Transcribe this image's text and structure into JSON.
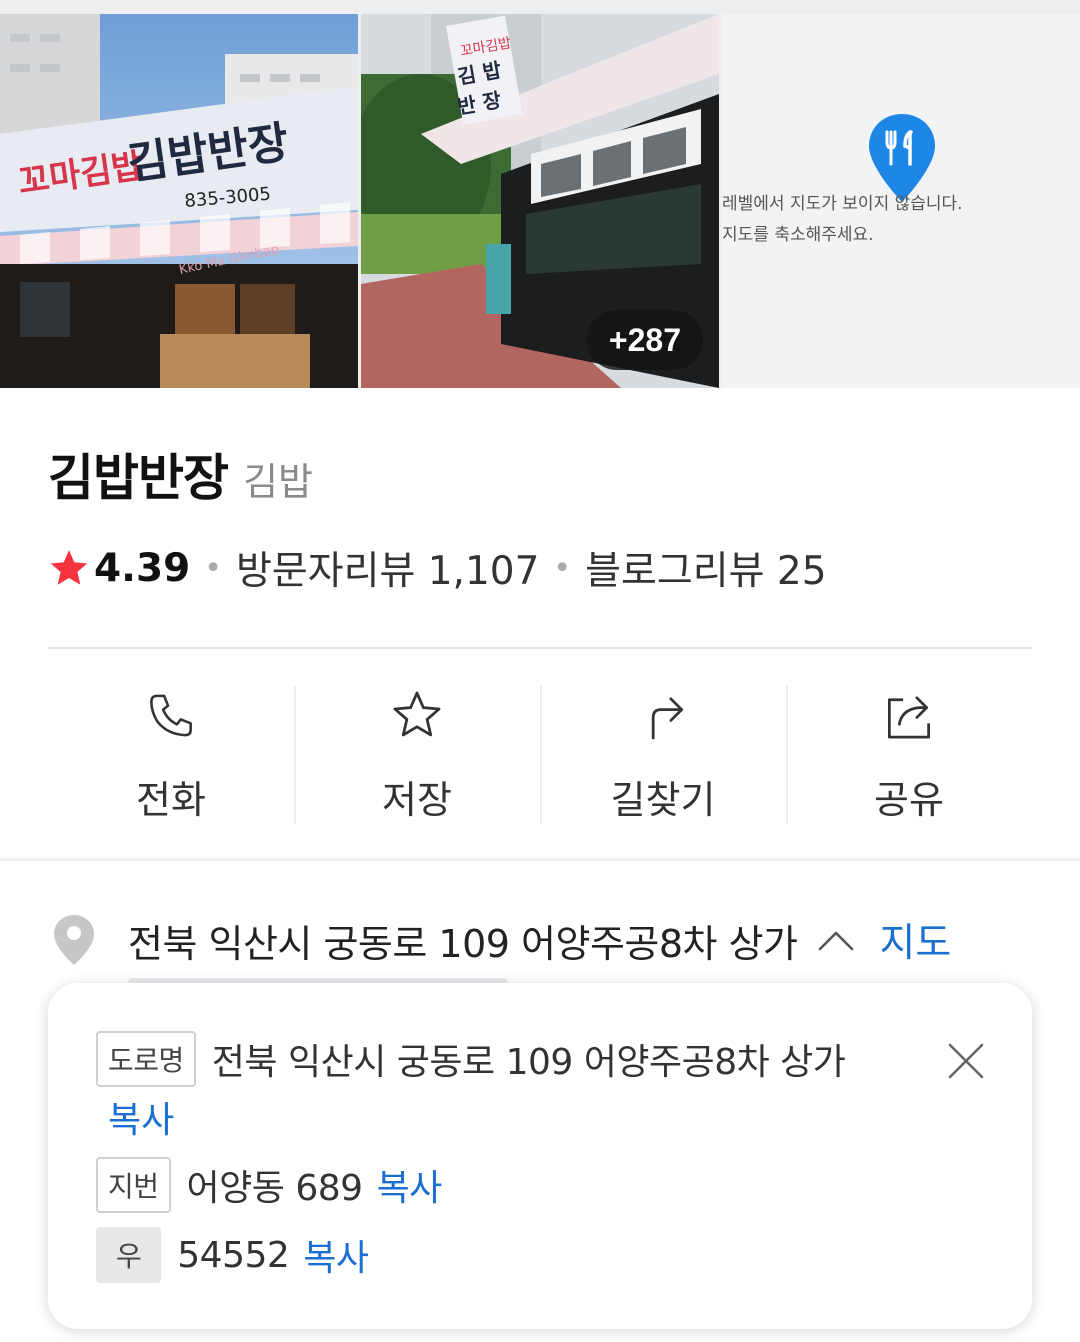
{
  "photos": {
    "more_count": "+287",
    "map_message_line1": "레벨에서 지도가 보이지 않습니다.",
    "map_message_line2": "지도를 축소해주세요.",
    "sign_texts": [
      "꼬마김밥",
      "김밥반장",
      "835-3005",
      "Kko Ma Gimbap"
    ]
  },
  "place": {
    "name": "김밥반장",
    "category": "김밥",
    "rating": "4.39",
    "visitor_review": "방문자리뷰 1,107",
    "blog_review": "블로그리뷰 25"
  },
  "actions": [
    {
      "label": "전화",
      "icon": "phone-icon"
    },
    {
      "label": "저장",
      "icon": "star-outline-icon"
    },
    {
      "label": "길찾기",
      "icon": "directions-icon"
    },
    {
      "label": "공유",
      "icon": "share-icon"
    }
  ],
  "address": {
    "text": "전북 익산시 궁동로 109 어양주공8차 상가",
    "map_link": "지도"
  },
  "address_popup": {
    "road_label": "도로명",
    "road_address": "전북 익산시 궁동로 109 어양주공8차 상가",
    "lot_label": "지번",
    "lot_address": "어양동 689",
    "zip_label": "우",
    "zip_code": "54552",
    "copy_label": "복사"
  },
  "colors": {
    "accent_blue": "#1b6fd1",
    "star_red": "#f5333f",
    "map_pin_blue": "#1e86e6"
  }
}
